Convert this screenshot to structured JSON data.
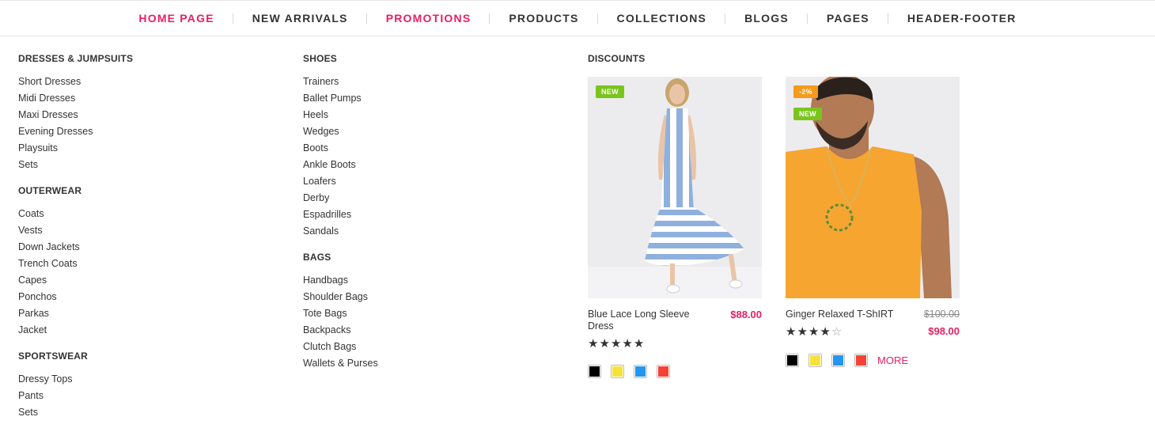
{
  "nav": {
    "items": [
      {
        "label": "HOME PAGE",
        "active": true
      },
      {
        "label": "NEW ARRIVALS",
        "active": false
      },
      {
        "label": "PROMOTIONS",
        "active": true
      },
      {
        "label": "PRODUCTS",
        "active": false
      },
      {
        "label": "COLLECTIONS",
        "active": false
      },
      {
        "label": "BLOGS",
        "active": false
      },
      {
        "label": "PAGES",
        "active": false
      },
      {
        "label": "HEADER-FOOTER",
        "active": false
      }
    ]
  },
  "menu": {
    "col1": [
      {
        "heading": "DRESSES & JUMPSUITS",
        "links": [
          "Short Dresses",
          "Midi Dresses",
          "Maxi Dresses",
          "Evening Dresses",
          "Playsuits",
          "Sets"
        ]
      },
      {
        "heading": "OUTERWEAR",
        "links": [
          "Coats",
          "Vests",
          "Down Jackets",
          "Trench Coats",
          "Capes",
          "Ponchos",
          "Parkas",
          "Jacket"
        ]
      },
      {
        "heading": "SPORTSWEAR",
        "links": [
          "Dressy Tops",
          "Pants",
          "Sets"
        ]
      }
    ],
    "col2": [
      {
        "heading": "SHOES",
        "links": [
          "Trainers",
          "Ballet Pumps",
          "Heels",
          "Wedges",
          "Boots",
          "Ankle Boots",
          "Loafers",
          "Derby",
          "Espadrilles",
          "Sandals"
        ]
      },
      {
        "heading": "BAGS",
        "links": [
          "Handbags",
          "Shoulder Bags",
          "Tote Bags",
          "Backpacks",
          "Clutch Bags",
          "Wallets & Purses"
        ]
      }
    ]
  },
  "discounts": {
    "heading": "DISCOUNTS",
    "products": [
      {
        "name": "Blue Lace Long Sleeve Dress",
        "price": "$88.00",
        "badges": [
          "NEW"
        ],
        "rating": 5,
        "swatches": [
          "#000000",
          "#f5e33a",
          "#2196f3",
          "#f44336"
        ]
      },
      {
        "name": "Ginger Relaxed T-ShIRT",
        "old_price": "$100.00",
        "price": "$98.00",
        "badges": [
          "-2%",
          "NEW"
        ],
        "rating": 4.5,
        "swatches": [
          "#000000",
          "#f5e33a",
          "#2196f3",
          "#f44336"
        ],
        "more_label": "MORE"
      }
    ]
  },
  "colors": {
    "accent": "#e91e63",
    "badge_new": "#7ac51c",
    "badge_sale": "#f59a1a"
  }
}
